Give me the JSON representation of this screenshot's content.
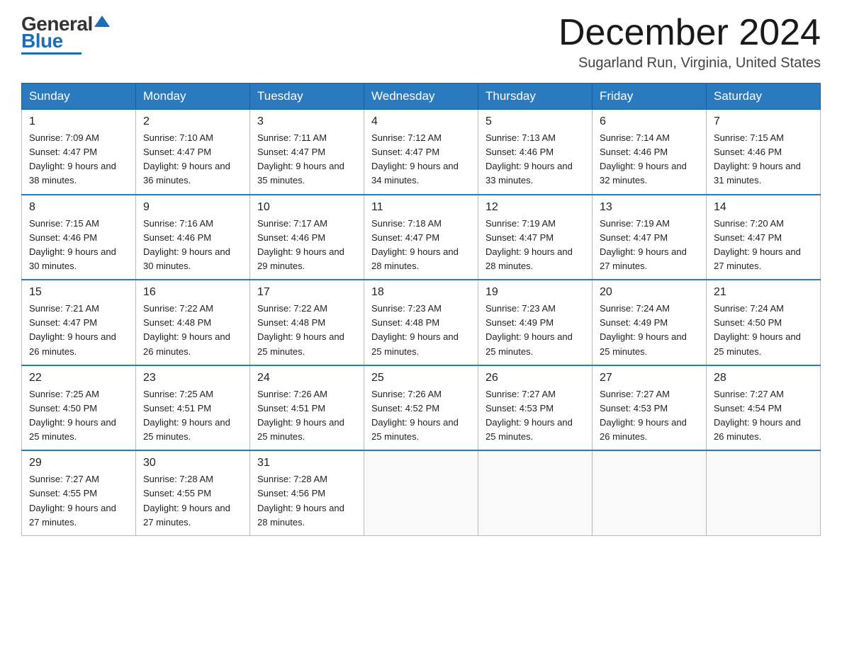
{
  "header": {
    "logo_general": "General",
    "logo_blue": "Blue",
    "month_title": "December 2024",
    "location": "Sugarland Run, Virginia, United States"
  },
  "days_of_week": [
    "Sunday",
    "Monday",
    "Tuesday",
    "Wednesday",
    "Thursday",
    "Friday",
    "Saturday"
  ],
  "weeks": [
    [
      {
        "day": "1",
        "sunrise": "7:09 AM",
        "sunset": "4:47 PM",
        "daylight": "9 hours and 38 minutes."
      },
      {
        "day": "2",
        "sunrise": "7:10 AM",
        "sunset": "4:47 PM",
        "daylight": "9 hours and 36 minutes."
      },
      {
        "day": "3",
        "sunrise": "7:11 AM",
        "sunset": "4:47 PM",
        "daylight": "9 hours and 35 minutes."
      },
      {
        "day": "4",
        "sunrise": "7:12 AM",
        "sunset": "4:47 PM",
        "daylight": "9 hours and 34 minutes."
      },
      {
        "day": "5",
        "sunrise": "7:13 AM",
        "sunset": "4:46 PM",
        "daylight": "9 hours and 33 minutes."
      },
      {
        "day": "6",
        "sunrise": "7:14 AM",
        "sunset": "4:46 PM",
        "daylight": "9 hours and 32 minutes."
      },
      {
        "day": "7",
        "sunrise": "7:15 AM",
        "sunset": "4:46 PM",
        "daylight": "9 hours and 31 minutes."
      }
    ],
    [
      {
        "day": "8",
        "sunrise": "7:15 AM",
        "sunset": "4:46 PM",
        "daylight": "9 hours and 30 minutes."
      },
      {
        "day": "9",
        "sunrise": "7:16 AM",
        "sunset": "4:46 PM",
        "daylight": "9 hours and 30 minutes."
      },
      {
        "day": "10",
        "sunrise": "7:17 AM",
        "sunset": "4:46 PM",
        "daylight": "9 hours and 29 minutes."
      },
      {
        "day": "11",
        "sunrise": "7:18 AM",
        "sunset": "4:47 PM",
        "daylight": "9 hours and 28 minutes."
      },
      {
        "day": "12",
        "sunrise": "7:19 AM",
        "sunset": "4:47 PM",
        "daylight": "9 hours and 28 minutes."
      },
      {
        "day": "13",
        "sunrise": "7:19 AM",
        "sunset": "4:47 PM",
        "daylight": "9 hours and 27 minutes."
      },
      {
        "day": "14",
        "sunrise": "7:20 AM",
        "sunset": "4:47 PM",
        "daylight": "9 hours and 27 minutes."
      }
    ],
    [
      {
        "day": "15",
        "sunrise": "7:21 AM",
        "sunset": "4:47 PM",
        "daylight": "9 hours and 26 minutes."
      },
      {
        "day": "16",
        "sunrise": "7:22 AM",
        "sunset": "4:48 PM",
        "daylight": "9 hours and 26 minutes."
      },
      {
        "day": "17",
        "sunrise": "7:22 AM",
        "sunset": "4:48 PM",
        "daylight": "9 hours and 25 minutes."
      },
      {
        "day": "18",
        "sunrise": "7:23 AM",
        "sunset": "4:48 PM",
        "daylight": "9 hours and 25 minutes."
      },
      {
        "day": "19",
        "sunrise": "7:23 AM",
        "sunset": "4:49 PM",
        "daylight": "9 hours and 25 minutes."
      },
      {
        "day": "20",
        "sunrise": "7:24 AM",
        "sunset": "4:49 PM",
        "daylight": "9 hours and 25 minutes."
      },
      {
        "day": "21",
        "sunrise": "7:24 AM",
        "sunset": "4:50 PM",
        "daylight": "9 hours and 25 minutes."
      }
    ],
    [
      {
        "day": "22",
        "sunrise": "7:25 AM",
        "sunset": "4:50 PM",
        "daylight": "9 hours and 25 minutes."
      },
      {
        "day": "23",
        "sunrise": "7:25 AM",
        "sunset": "4:51 PM",
        "daylight": "9 hours and 25 minutes."
      },
      {
        "day": "24",
        "sunrise": "7:26 AM",
        "sunset": "4:51 PM",
        "daylight": "9 hours and 25 minutes."
      },
      {
        "day": "25",
        "sunrise": "7:26 AM",
        "sunset": "4:52 PM",
        "daylight": "9 hours and 25 minutes."
      },
      {
        "day": "26",
        "sunrise": "7:27 AM",
        "sunset": "4:53 PM",
        "daylight": "9 hours and 25 minutes."
      },
      {
        "day": "27",
        "sunrise": "7:27 AM",
        "sunset": "4:53 PM",
        "daylight": "9 hours and 26 minutes."
      },
      {
        "day": "28",
        "sunrise": "7:27 AM",
        "sunset": "4:54 PM",
        "daylight": "9 hours and 26 minutes."
      }
    ],
    [
      {
        "day": "29",
        "sunrise": "7:27 AM",
        "sunset": "4:55 PM",
        "daylight": "9 hours and 27 minutes."
      },
      {
        "day": "30",
        "sunrise": "7:28 AM",
        "sunset": "4:55 PM",
        "daylight": "9 hours and 27 minutes."
      },
      {
        "day": "31",
        "sunrise": "7:28 AM",
        "sunset": "4:56 PM",
        "daylight": "9 hours and 28 minutes."
      },
      null,
      null,
      null,
      null
    ]
  ]
}
